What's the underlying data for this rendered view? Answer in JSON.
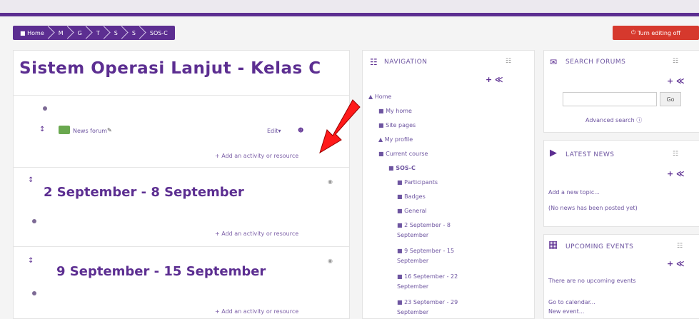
{
  "breadcrumb": [
    "Home",
    "M",
    "G",
    "T",
    "S",
    "S",
    "SOS-C"
  ],
  "turn_editing": "Turn editing off",
  "course": {
    "title": "Sistem Operasi Lanjut - Kelas C",
    "news_forum": "News forum",
    "edit": "Edit",
    "add_activity": "Add an activity or resource",
    "section1": "2 September - 8 September",
    "section2": "9 September - 15 September"
  },
  "navigation": {
    "heading": "NAVIGATION",
    "items": [
      "Home",
      "My home",
      "Site pages",
      "My profile",
      "Current course",
      "SOS-C",
      "Participants",
      "Badges",
      "General",
      "2 September - 8",
      "September",
      "9 September - 15",
      "September",
      "16 September - 22",
      "September",
      "23 September - 29",
      "September"
    ]
  },
  "search_forums": {
    "heading": "SEARCH FORUMS",
    "go": "Go",
    "advanced": "Advanced search"
  },
  "latest_news": {
    "heading": "LATEST NEWS",
    "add_topic": "Add a new topic...",
    "none": "(No news has been posted yet)"
  },
  "upcoming_events": {
    "heading": "UPCOMING EVENTS",
    "none": "There are no upcoming events",
    "calendar": "Go to calendar...",
    "new_event": "New event..."
  }
}
